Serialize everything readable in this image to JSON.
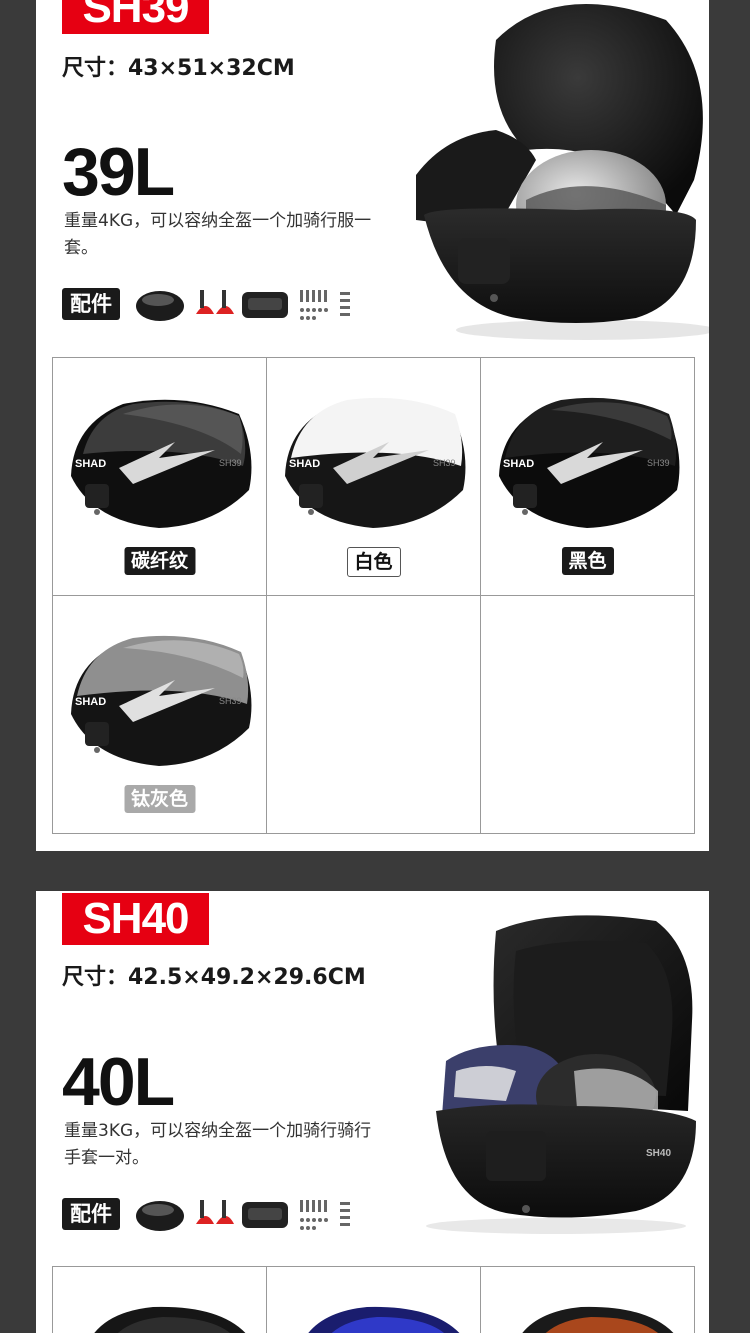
{
  "products": [
    {
      "model": "SH39",
      "size": "尺寸：43×51×32CM",
      "capacity": "39L",
      "description": "重量4KG，可以容纳全盔一个加骑行服一套。",
      "accessories_label": "配件",
      "box_label": "SH39",
      "colors": [
        {
          "name": "碳纤纹",
          "tag_style": "dark",
          "lid": "carbon"
        },
        {
          "name": "白色",
          "tag_style": "white",
          "lid": "white"
        },
        {
          "name": "黑色",
          "tag_style": "dark",
          "lid": "black"
        },
        {
          "name": "钛灰色",
          "tag_style": "grey",
          "lid": "titanium"
        }
      ]
    },
    {
      "model": "SH40",
      "size": "尺寸：42.5×49.2×29.6CM",
      "capacity": "40L",
      "description": "重量3KG，可以容纳全盔一个加骑行骑行手套一对。",
      "accessories_label": "配件",
      "box_label": "SH40"
    }
  ],
  "brand_logo": "SHAD",
  "colors": {
    "accent_red": "#e60012",
    "background": "#3a3a3a",
    "panel": "#ffffff"
  }
}
